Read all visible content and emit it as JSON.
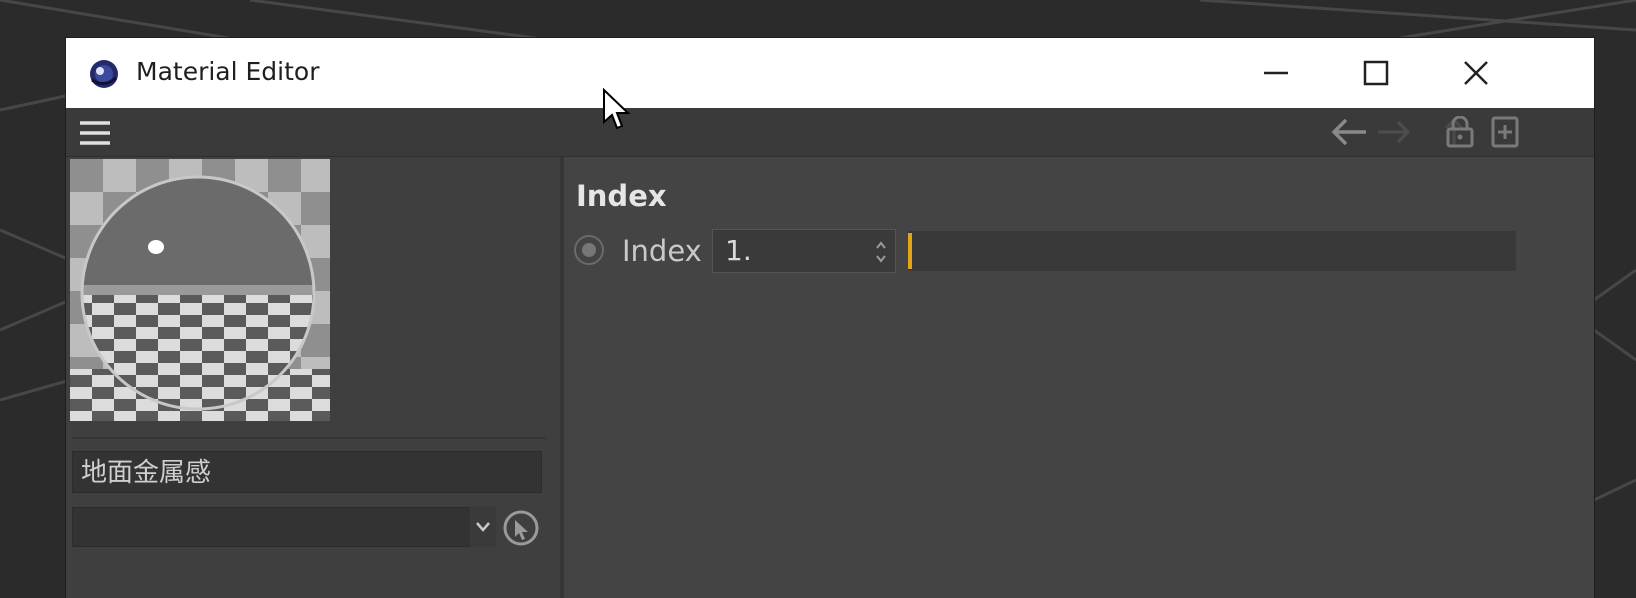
{
  "window": {
    "title": "Material Editor",
    "icons": [
      "app-icon",
      "minimize-icon",
      "maximize-icon",
      "close-icon"
    ]
  },
  "toolbar": {
    "icons": [
      "hamburger-menu-icon",
      "arrow-left-icon",
      "arrow-right-icon",
      "arrow-up-icon",
      "lock-icon",
      "new-panel-icon"
    ]
  },
  "material": {
    "name": "地面金属感",
    "layer_value": ""
  },
  "attributes": {
    "section_title": "Index",
    "params": [
      {
        "label": "Index",
        "value": "1.",
        "slider_fraction": 0.0
      }
    ]
  },
  "colors": {
    "accent": "#e2a418",
    "panel": "#444444",
    "titlebar": "#ffffff"
  }
}
